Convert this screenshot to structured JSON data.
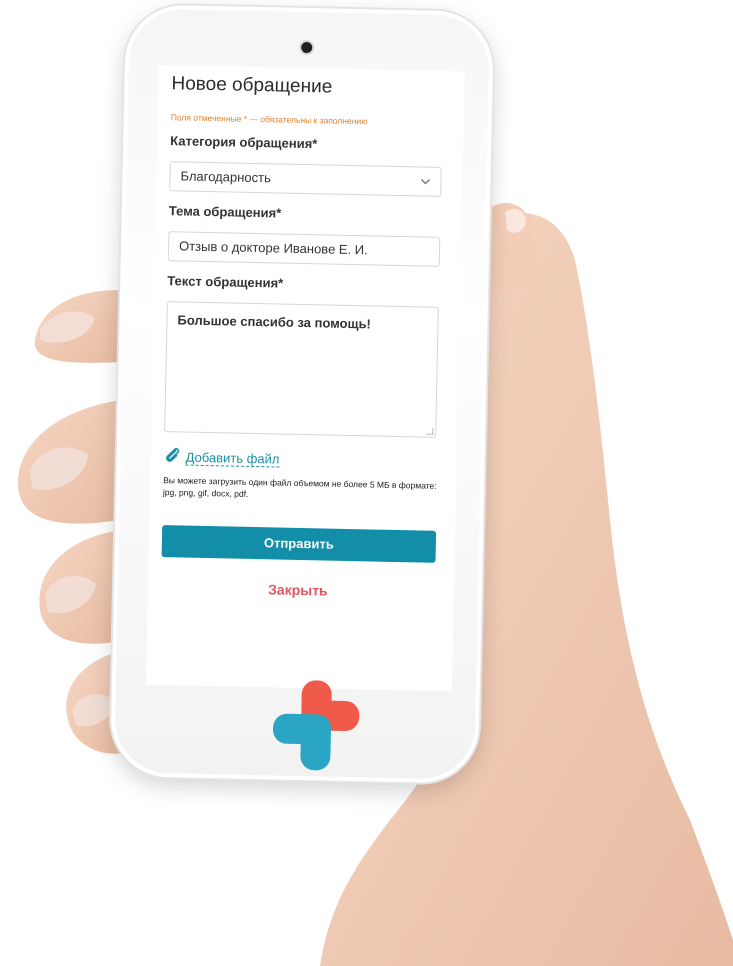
{
  "form": {
    "title": "Новое обращение",
    "required_note": "Поля отмеченные * — обязательны к заполнению",
    "category_label": "Категория обращения*",
    "category_value": "Благодарность",
    "topic_label": "Тема обращения*",
    "topic_value": "Отзыв о докторе Иванове Е. И.",
    "text_label": "Текст обращения*",
    "text_value": "Большое спасибо за помощь!",
    "add_file": "Добавить файл",
    "file_hint": "Вы можете загрузить один файл объемом не более 5 МБ в формате: jpg, png, gif, docx, pdf.",
    "submit": "Отправить",
    "close": "Закрыть"
  },
  "icons": {
    "select_chevron": "chevron-down-icon",
    "attach": "paperclip-icon",
    "logo": "medical-cross-logo"
  },
  "colors": {
    "accent": "#138ea8",
    "link": "#1a8fa6",
    "close": "#e0575f",
    "note": "#e0822b",
    "logo_red": "#f05a4a",
    "logo_teal": "#2aa6c4"
  }
}
